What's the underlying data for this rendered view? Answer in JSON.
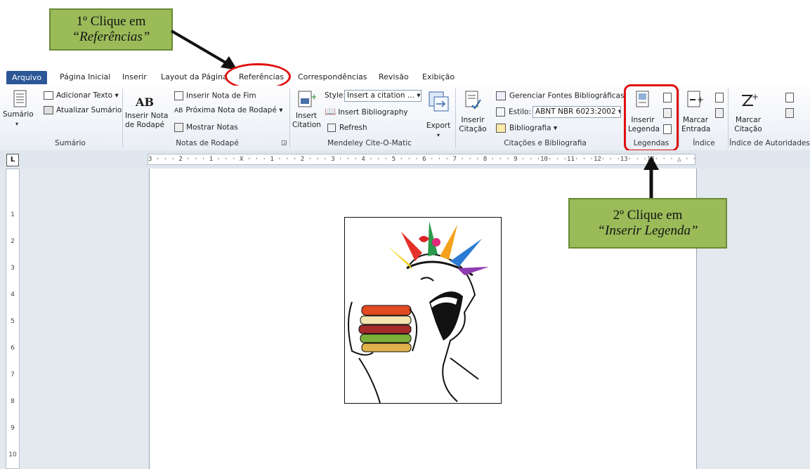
{
  "callouts": {
    "first": {
      "line1": "1º Clique em",
      "line2": "“Referências”"
    },
    "second": {
      "line1": "2º Clique em",
      "line2": "“Inserir Legenda”"
    }
  },
  "tabs": [
    {
      "label": "Arquivo"
    },
    {
      "label": "Página Inicial"
    },
    {
      "label": "Inserir"
    },
    {
      "label": "Layout da Página"
    },
    {
      "label": "Referências"
    },
    {
      "label": "Correspondências"
    },
    {
      "label": "Revisão"
    },
    {
      "label": "Exibição"
    }
  ],
  "ribbon": {
    "sumario": {
      "big_label": "Sumário",
      "add_text": "Adicionar Texto",
      "update": "Atualizar Sumário",
      "group": "Sumário"
    },
    "notas": {
      "ab": "AB",
      "big_label1": "Inserir Nota",
      "big_label2": "de Rodapé",
      "end_note": "Inserir Nota de Fim",
      "next_note": "Próxima Nota de Rodapé",
      "show_notes": "Mostrar Notas",
      "group": "Notas de Rodapé"
    },
    "mendeley": {
      "insert1": "Insert",
      "insert2": "Citation",
      "style_label": "Style:",
      "style_value": "Insert a citation ...",
      "bibliography": "Insert Bibliography",
      "refresh": "Refresh",
      "export": "Export",
      "group": "Mendeley Cite-O-Matic"
    },
    "citacoes": {
      "big1": "Inserir",
      "big2": "Citação",
      "manage": "Gerenciar Fontes Bibliográficas",
      "style_label": "Estilo:",
      "style_value": "ABNT NBR 6023:2002",
      "bibliografia": "Bibliografia",
      "group": "Citações e Bibliografia"
    },
    "legendas": {
      "big1": "Inserir",
      "big2": "Legenda",
      "group": "Legendas"
    },
    "indice": {
      "big1": "Marcar",
      "big2": "Entrada",
      "group": "Índice"
    },
    "autoridades": {
      "big1": "Marcar",
      "big2": "Citação",
      "group": "Índice de Autoridades"
    }
  },
  "ruler": {
    "h_marks": "3 · · · 2 · · · 1 · · · X · · · 1 · · · 2 · · · 3 · · · 4 · · · 5 · · · 6 · · · 7 · · · 8 · · · 9 · · ·10· · ·11· · ·12· · ·13· · ·14· · · △ · · 16 · · ·17· · ·",
    "v_marks": [
      "1",
      "2",
      "3",
      "4",
      "5",
      "6",
      "7",
      "8",
      "9",
      "10"
    ],
    "corner": "L"
  },
  "colors": {
    "callout_bg": "#9bbb59",
    "highlight": "#e01010",
    "file_tab": "#2b5797"
  }
}
